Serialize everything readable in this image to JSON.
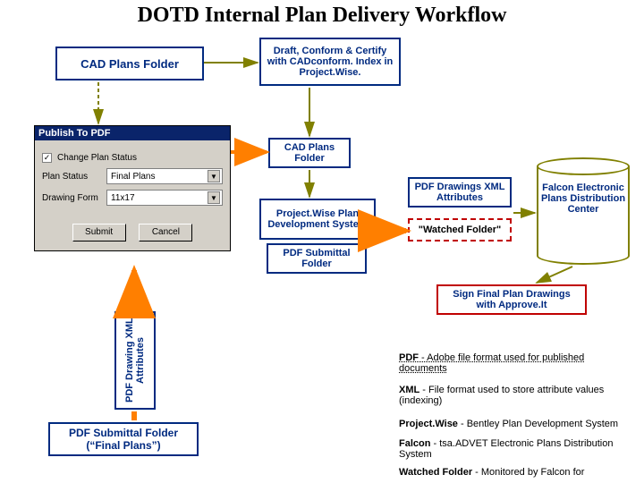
{
  "title": "DOTD Internal Plan Delivery Workflow",
  "boxes": {
    "cad_top": "CAD Plans Folder",
    "draft": "Draft, Conform & Certify with CADconform. Index in Project.Wise.",
    "cad_small": "CAD Plans Folder",
    "pwds": "Project.Wise Plan Development System",
    "pdf_sub": "PDF Submittal Folder",
    "attrs": "PDF Drawings XML Attributes",
    "watched": "\"Watched Folder\"",
    "sign": "Sign Final Plan Drawings with Approve.It",
    "vert_label": "PDF Drawing XML Attributes",
    "final_box": "PDF Submittal Folder (“Final  Plans”)"
  },
  "cyl_label": "Falcon Electronic Plans Distribution Center",
  "dialog": {
    "title": "Publish To PDF",
    "checkbox": "Change Plan Status",
    "row1_label": "Plan Status",
    "row1_value": "Final Plans",
    "row2_label": "Drawing Form",
    "row2_value": "11x17",
    "submit": "Submit",
    "cancel": "Cancel"
  },
  "glossary": {
    "pdf": {
      "term": "PDF",
      "def": " - Adobe file format used for published documents"
    },
    "xml": {
      "term": "XML",
      "def": " -  File format used to store attribute values (indexing)"
    },
    "pw": {
      "term": "Project.Wise",
      "def": " - Bentley Plan Development System"
    },
    "fal": {
      "term": "Falcon",
      "def": " -  tsa.ADVET Electronic Plans Distribution System"
    },
    "wf": {
      "term": "Watched Folder",
      "def": " -  Monitored by Falcon for"
    }
  }
}
